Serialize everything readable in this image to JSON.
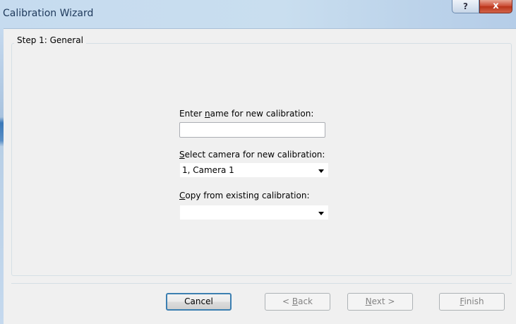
{
  "window": {
    "title": "Calibration Wizard",
    "help_label": "?",
    "close_label": "x"
  },
  "step": {
    "legend": "Step 1: General",
    "name_label_pre": "Enter ",
    "name_label_key": "n",
    "name_label_post": "ame for new calibration:",
    "name_value": "",
    "camera_label_key": "S",
    "camera_label_post": "elect camera for new calibration:",
    "camera_value": "1, Camera 1",
    "copy_label_key": "C",
    "copy_label_post": "opy from existing calibration:",
    "copy_value": ""
  },
  "buttons": {
    "cancel": "Cancel",
    "back_pre": "< ",
    "back_key": "B",
    "back_post": "ack",
    "next_key": "N",
    "next_post": "ext >",
    "finish_key": "F",
    "finish_post": "inish"
  },
  "colors": {
    "titlebar": "#c6dbef",
    "close_red": "#c9472f",
    "focus_border": "#3c7fb1"
  }
}
